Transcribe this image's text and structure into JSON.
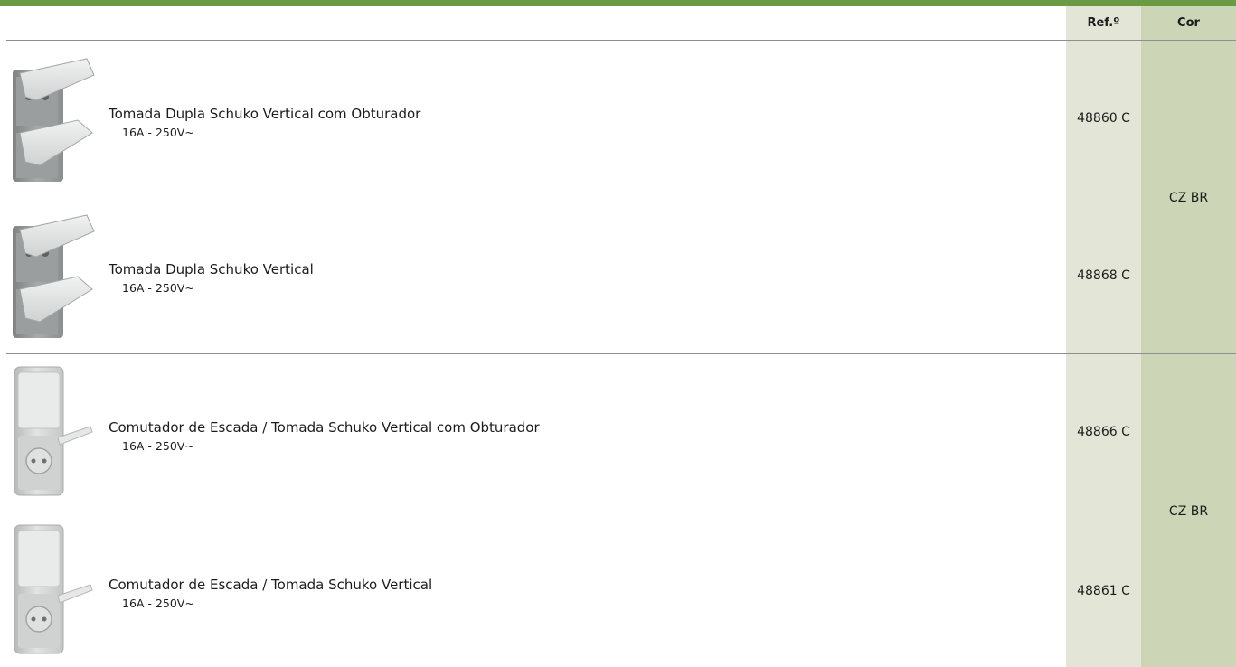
{
  "table": {
    "header": {
      "ref": "Ref.º",
      "cor": "Cor"
    },
    "groups": [
      {
        "color": "CZ BR",
        "products": [
          {
            "name": "Tomada Dupla Schuko Vertical com Obturador",
            "spec": "16A - 250V~",
            "ref": "48860 C",
            "image": "double-socket-image"
          },
          {
            "name": "Tomada Dupla Schuko Vertical",
            "spec": "16A - 250V~",
            "ref": "48868 C",
            "image": "double-socket-image"
          }
        ]
      },
      {
        "color": "CZ BR",
        "products": [
          {
            "name": "Comutador de Escada / Tomada Schuko Vertical com Obturador",
            "spec": "16A - 250V~",
            "ref": "48866 C",
            "image": "switch-socket-image"
          },
          {
            "name": "Comutador de Escada / Tomada Schuko Vertical",
            "spec": "16A - 250V~",
            "ref": "48861 C",
            "image": "switch-socket-image"
          }
        ]
      }
    ]
  }
}
